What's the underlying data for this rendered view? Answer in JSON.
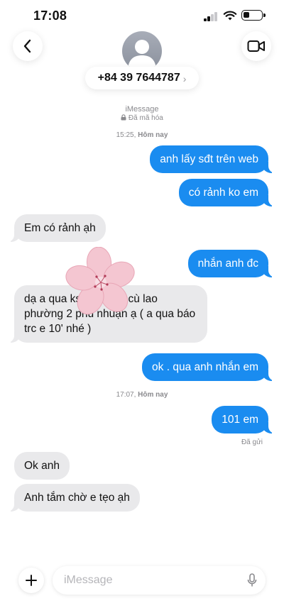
{
  "status_bar": {
    "time": "17:08"
  },
  "header": {
    "contact_number": "+84 39 7644787",
    "chevron": "›",
    "service_label": "iMessage",
    "encryption_label": "Đã mã hóa",
    "icons": {
      "back": "chevron-left-icon",
      "video": "video-camera-icon",
      "avatar": "person-icon"
    }
  },
  "conversation": {
    "timestamps": [
      {
        "time": "15:25",
        "day": "Hôm nay"
      },
      {
        "time": "17:07",
        "day": "Hôm nay"
      }
    ],
    "messages": [
      {
        "from": "me",
        "text": "anh lấy sđt trên web"
      },
      {
        "from": "me",
        "text": "có rảnh ko em"
      },
      {
        "from": "them",
        "text": "Em có rảnh ạh"
      },
      {
        "from": "me",
        "text": "nhắn anh đc"
      },
      {
        "from": "them",
        "text": "dạ a qua ks c… 38/4 cù lao phường 2 phú nhuận ạ ( a qua báo trc e 10' nhé )"
      },
      {
        "from": "me",
        "text": "ok . qua anh nhắn em"
      },
      {
        "from": "me",
        "text": "101 em"
      },
      {
        "from": "them",
        "text": "Ok anh"
      },
      {
        "from": "them",
        "text": "Anh tắm chờ e tẹo ạh"
      }
    ],
    "delivered_status": "Đã gửi"
  },
  "composer": {
    "placeholder": "iMessage",
    "value": "",
    "icons": {
      "add": "plus-icon",
      "mic": "microphone-icon"
    }
  },
  "colors": {
    "outgoing": "#1a8cf0",
    "incoming": "#e9e9eb",
    "meta_text": "#8a8a8e"
  }
}
